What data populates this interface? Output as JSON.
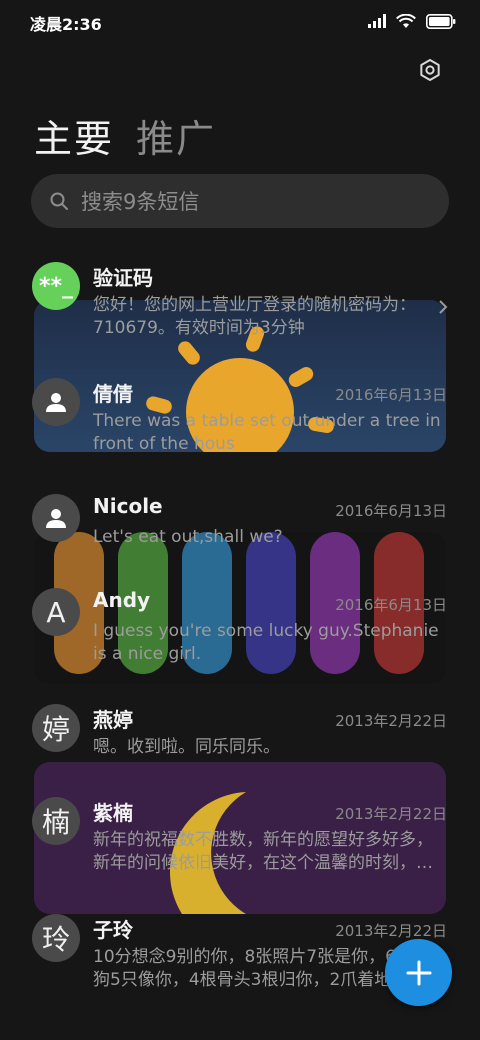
{
  "status_bar": {
    "time": "凌晨2:36",
    "icons": [
      "signal-icon",
      "wifi-icon",
      "battery-icon"
    ]
  },
  "header": {
    "settings_icon": "settings-icon"
  },
  "tabs": [
    {
      "label": "主要",
      "active": true
    },
    {
      "label": "推广",
      "active": false
    }
  ],
  "search": {
    "placeholder": "搜索9条短信"
  },
  "messages": [
    {
      "sender": "验证码",
      "avatar": "**_",
      "date": "",
      "preview": [
        "您好！您的网上营业厅登录的随机密码为：",
        "710679。有效时间为3分钟"
      ],
      "has_chevron": true
    },
    {
      "sender": "倩倩",
      "avatar": "person",
      "date": "2016年6月13日",
      "preview": [
        "There was a table set out under a tree in",
        "front of the hous"
      ]
    },
    {
      "sender": "Nicole",
      "avatar": "person",
      "date": "2016年6月13日",
      "preview": [
        "Let's eat out,shall we?"
      ]
    },
    {
      "sender": "Andy",
      "avatar": "A",
      "date": "2016年6月13日",
      "preview": [
        "I guess you're some lucky guy.Stephanie",
        "is a nice girl."
      ]
    },
    {
      "sender": "燕婷",
      "avatar": "婷",
      "date": "2013年2月22日",
      "preview": [
        "嗯。收到啦。同乐同乐。"
      ]
    },
    {
      "sender": "紫楠",
      "avatar": "楠",
      "date": "2013年2月22日",
      "preview": [
        "新年的祝福数不胜数，新年的愿望好多好多，",
        "新年的问候依旧美好，在这个温馨的时刻，…"
      ]
    },
    {
      "sender": "子玲",
      "avatar": "玲",
      "date": "2013年2月22日",
      "preview": [
        "10分想念9别的你，8张照片7张是你，6",
        "狗5只像你，4根骨头3根归你，2爪着地"
      ]
    }
  ],
  "fab": {
    "icon": "plus-icon"
  },
  "colors": {
    "background": "#161616",
    "accent": "#1e8fe0",
    "green_avatar": "#66d15a"
  }
}
